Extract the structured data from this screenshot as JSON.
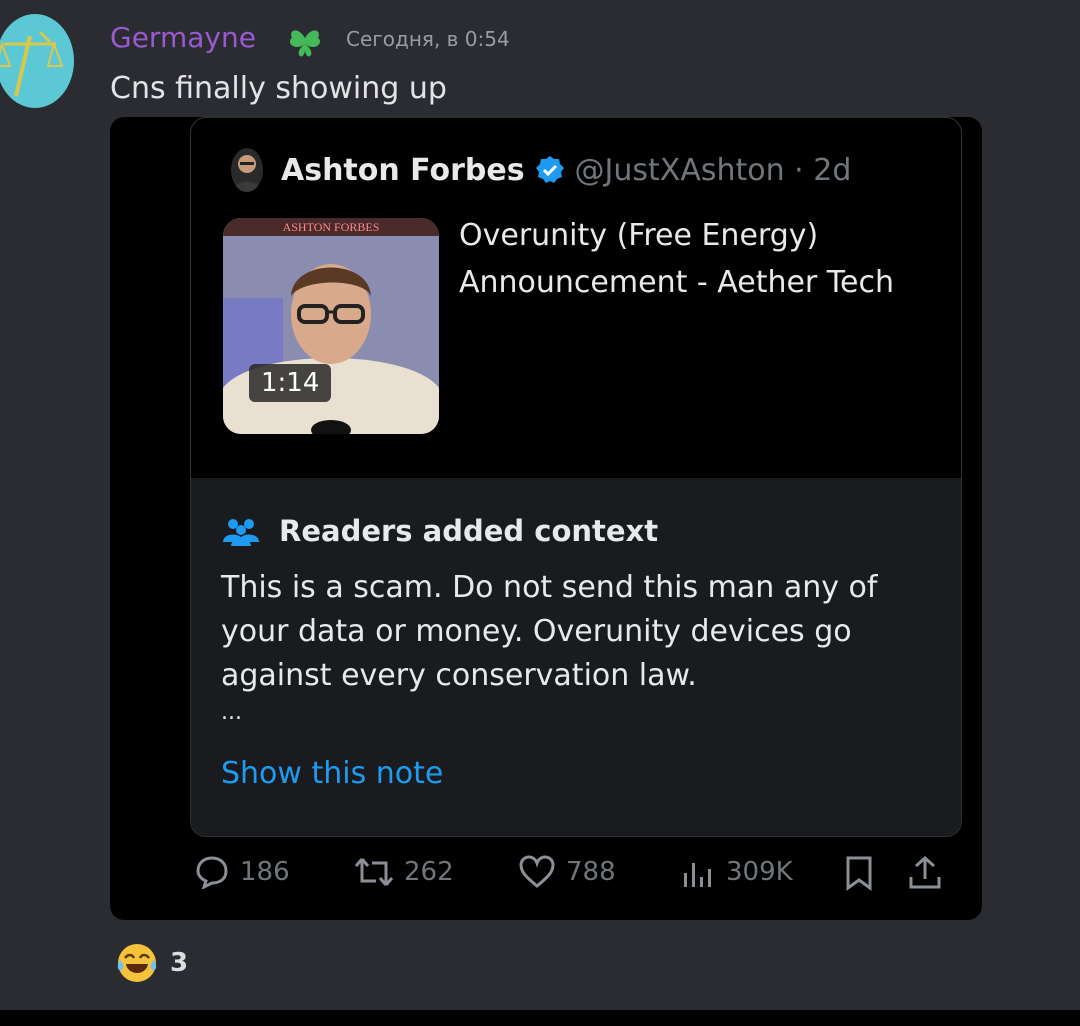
{
  "message": {
    "username": "Germayne",
    "username_color": "#9b59d0",
    "badge_icon": "clover-heart-icon",
    "timestamp": "Сегодня, в 0:54",
    "text": "Cns finally showing up"
  },
  "tweet": {
    "author_name": "Ashton Forbes",
    "author_handle": "@JustXAshton · 2d",
    "verified_color": "#1d9bf0",
    "video": {
      "banner_text": "ASHTON FORBES",
      "duration": "1:14"
    },
    "title": "Overunity (Free Energy) Announcement - Aether Tech",
    "context": {
      "heading": "Readers added context",
      "body": "This is a scam. Do not send this man any of your data or money. Overunity devices go against every conservation law.",
      "ellipsis": "...",
      "link": "Show this note",
      "link_color": "#1d9bf0"
    },
    "actions": {
      "replies": "186",
      "retweets": "262",
      "likes": "788",
      "views": "309K"
    }
  },
  "reaction": {
    "emoji": "joy-emoji",
    "count": "3"
  }
}
